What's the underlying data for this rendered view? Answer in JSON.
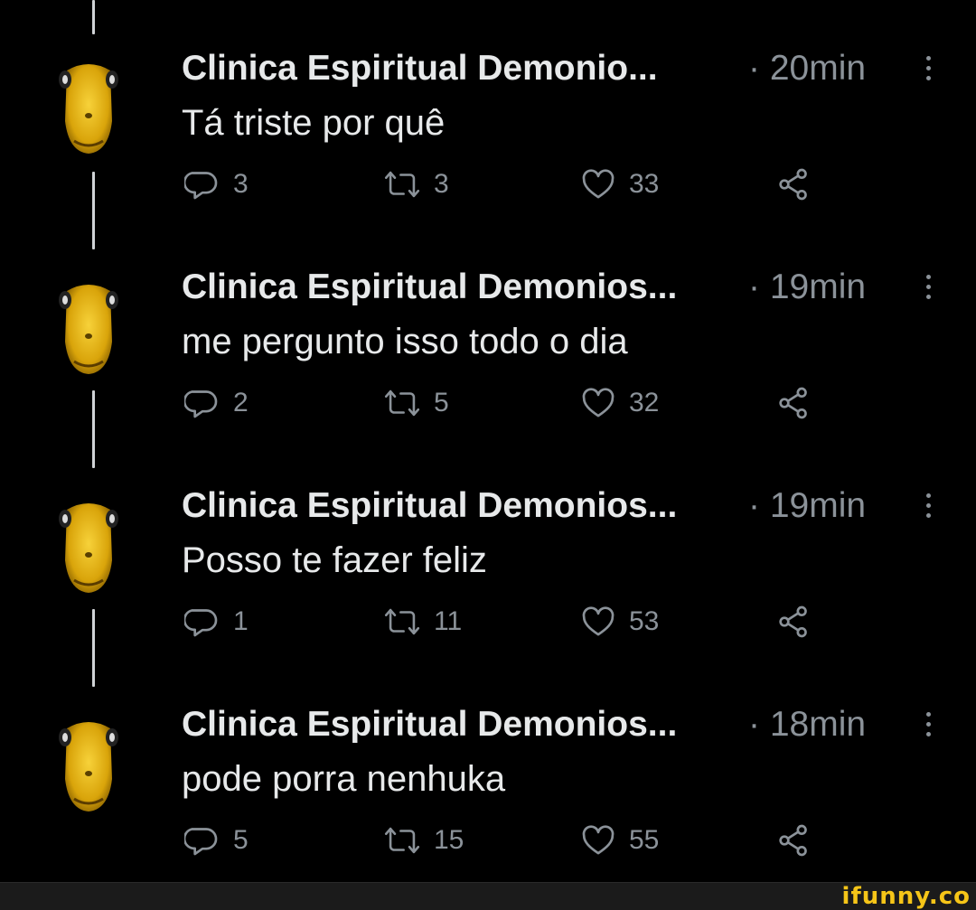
{
  "tweets": [
    {
      "name": "Clinica Espiritual Demonio...",
      "separator": "·",
      "time": "20min",
      "text": "Tá triste por quê",
      "replies": "3",
      "retweets": "3",
      "likes": "33"
    },
    {
      "name": "Clinica Espiritual Demonios...",
      "separator": "·",
      "time": "19min",
      "text": "me pergunto isso todo o dia",
      "replies": "2",
      "retweets": "5",
      "likes": "32"
    },
    {
      "name": "Clinica Espiritual Demonios...",
      "separator": "·",
      "time": "19min",
      "text": "Posso te fazer feliz",
      "replies": "1",
      "retweets": "11",
      "likes": "53"
    },
    {
      "name": "Clinica Espiritual Demonios...",
      "separator": "·",
      "time": "18min",
      "text": "pode porra nenhuka",
      "replies": "5",
      "retweets": "15",
      "likes": "55"
    }
  ],
  "icons": {
    "reply": "reply-icon",
    "retweet": "retweet-icon",
    "like": "heart-icon",
    "share": "share-icon",
    "more": "more-options-icon",
    "avatar": "yellow-face-avatar"
  },
  "colors": {
    "background": "#000000",
    "text": "#e7e9ea",
    "secondary": "#8b9299",
    "thread_line": "#d0d3d6",
    "avatar": "#e8b80c",
    "watermark": "#f5c518"
  },
  "footer": {
    "watermark": "ifunny.co"
  }
}
